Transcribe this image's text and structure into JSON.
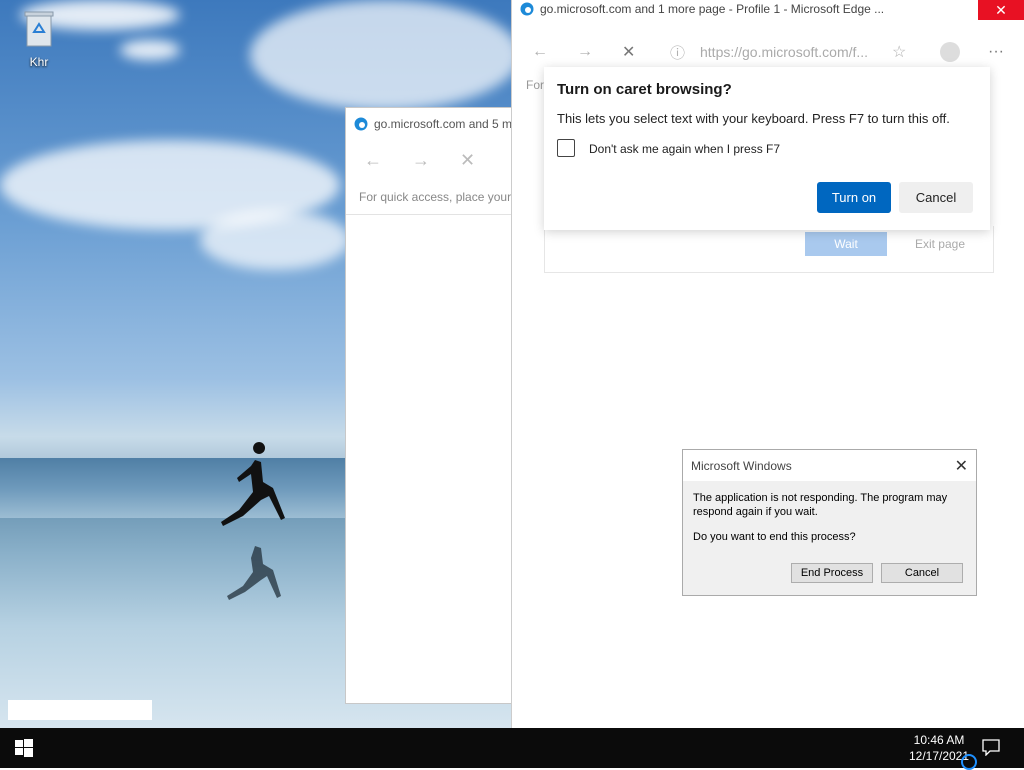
{
  "desktop": {
    "recycle_label": "Khr"
  },
  "edge_back": {
    "title": "go.microsoft.com and 5 m",
    "favorites_hint": "For quick access, place your"
  },
  "edge_front": {
    "title": "go.microsoft.com and 1 more page - Profile 1 - Microsoft Edge ...",
    "url": "https://go.microsoft.com/f...",
    "favorites_hint": "For",
    "wait_label": "Wait",
    "exit_label": "Exit page"
  },
  "caret_dialog": {
    "title": "Turn on caret browsing?",
    "description": "This lets you select text with your keyboard. Press F7 to turn this off.",
    "checkbox_label": "Don't ask me again when I press F7",
    "checked": false,
    "turn_on_label": "Turn on",
    "cancel_label": "Cancel"
  },
  "not_responding_dialog": {
    "title": "Microsoft Windows",
    "message": "The application is not responding. The program may respond again if you wait.",
    "question": "Do you want to end this process?",
    "end_label": "End Process",
    "cancel_label": "Cancel"
  },
  "taskbar": {
    "time": "10:46 AM",
    "date": "12/17/2021"
  },
  "colors": {
    "accent": "#0067c0",
    "close_red": "#e81123"
  }
}
